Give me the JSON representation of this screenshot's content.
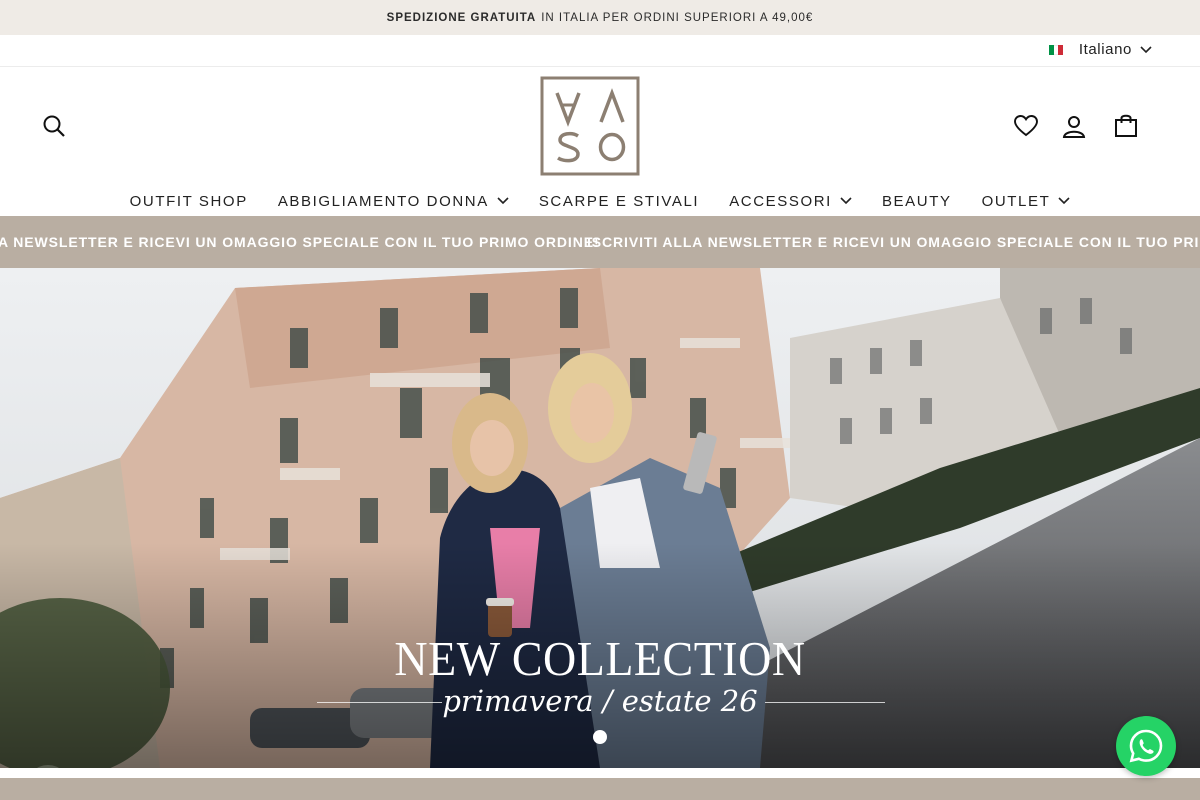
{
  "announcement": {
    "bold": "SPEDIZIONE GRATUITA",
    "text": "IN ITALIA PER ORDINI SUPERIORI A 49,00€"
  },
  "language": {
    "label": "Italiano",
    "flag_colors": [
      "#009246",
      "#ffffff",
      "#ce2b37"
    ]
  },
  "header": {
    "logo_letters": [
      "V",
      "A",
      "S",
      "O"
    ],
    "icons": [
      "search-icon",
      "heart-icon",
      "account-icon",
      "bag-icon"
    ]
  },
  "nav": {
    "items": [
      {
        "label": "OUTFIT SHOP",
        "dropdown": false
      },
      {
        "label": "ABBIGLIAMENTO DONNA",
        "dropdown": true
      },
      {
        "label": "SCARPE E STIVALI",
        "dropdown": false
      },
      {
        "label": "ACCESSORI",
        "dropdown": true
      },
      {
        "label": "BEAUTY",
        "dropdown": false
      },
      {
        "label": "OUTLET",
        "dropdown": true
      }
    ]
  },
  "ticker": {
    "left_text": "A NEWSLETTER E RICEVI UN OMAGGIO SPECIALE CON IL TUO PRIMO ORDINE!",
    "right_text": "ISCRIVITI ALLA NEWSLETTER E RICEVI UN OMAGGIO SPECIALE CON IL TUO PRIMO ORD"
  },
  "hero": {
    "title": "NEW COLLECTION",
    "subtitle": "primavera / estate 26",
    "prev_glyph": "❮",
    "next_glyph": "❯"
  },
  "colors": {
    "accent": "#b9aea2",
    "announce_bg": "#efebe6",
    "whatsapp": "#25d366",
    "logo": "#8c7f72"
  }
}
